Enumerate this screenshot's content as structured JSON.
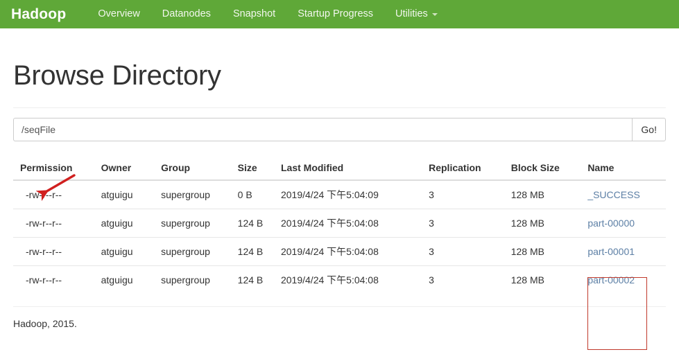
{
  "navbar": {
    "brand": "Hadoop",
    "items": [
      {
        "label": "Overview",
        "has_caret": false
      },
      {
        "label": "Datanodes",
        "has_caret": false
      },
      {
        "label": "Snapshot",
        "has_caret": false
      },
      {
        "label": "Startup Progress",
        "has_caret": false
      },
      {
        "label": "Utilities",
        "has_caret": true
      }
    ],
    "background_color": "#5fa838"
  },
  "page": {
    "title": "Browse Directory"
  },
  "path_form": {
    "value": "/seqFile",
    "placeholder": "/seqFile",
    "go_label": "Go!"
  },
  "annotation": {
    "arrow_color": "#d0201f",
    "highlight_box_color": "#c0392b"
  },
  "table": {
    "headers": [
      "Permission",
      "Owner",
      "Group",
      "Size",
      "Last Modified",
      "Replication",
      "Block Size",
      "Name"
    ],
    "rows": [
      {
        "permission": "-rw-r--r--",
        "owner": "atguigu",
        "group": "supergroup",
        "size": "0 B",
        "last_modified": "2019/4/24 下午5:04:09",
        "replication": "3",
        "block_size": "128 MB",
        "name": "_SUCCESS"
      },
      {
        "permission": "-rw-r--r--",
        "owner": "atguigu",
        "group": "supergroup",
        "size": "124 B",
        "last_modified": "2019/4/24 下午5:04:08",
        "replication": "3",
        "block_size": "128 MB",
        "name": "part-00000"
      },
      {
        "permission": "-rw-r--r--",
        "owner": "atguigu",
        "group": "supergroup",
        "size": "124 B",
        "last_modified": "2019/4/24 下午5:04:08",
        "replication": "3",
        "block_size": "128 MB",
        "name": "part-00001"
      },
      {
        "permission": "-rw-r--r--",
        "owner": "atguigu",
        "group": "supergroup",
        "size": "124 B",
        "last_modified": "2019/4/24 下午5:04:08",
        "replication": "3",
        "block_size": "128 MB",
        "name": "part-00002"
      }
    ]
  },
  "footer": {
    "text": "Hadoop, 2015."
  }
}
